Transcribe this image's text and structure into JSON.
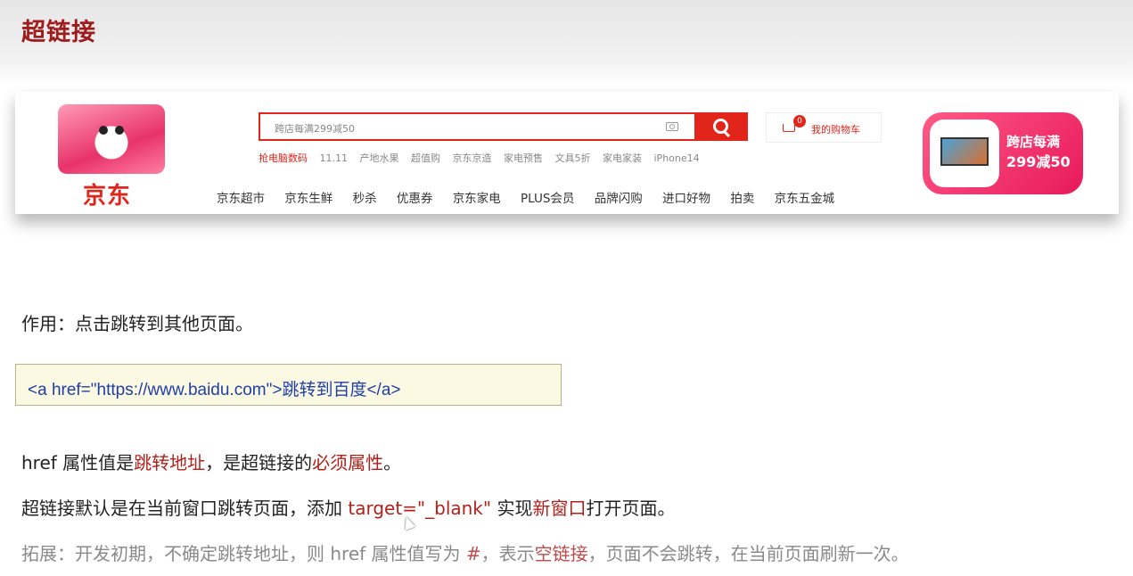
{
  "slide": {
    "title": "超链接"
  },
  "jd": {
    "logo_text": "京东",
    "search_placeholder": "跨店每满299减50",
    "hotwords": [
      "抢电脑数码",
      "11.11",
      "产地水果",
      "超值购",
      "京东京造",
      "家电预售",
      "文具5折",
      "家电家装",
      "iPhone14"
    ],
    "cart": {
      "count": "0",
      "label": "我的购物车"
    },
    "nav": [
      "京东超市",
      "京东生鲜",
      "秒杀",
      "优惠券",
      "京东家电",
      "PLUS会员",
      "品牌闪购",
      "进口好物",
      "拍卖",
      "京东五金城"
    ],
    "promo": {
      "line1": "跨店每满",
      "line2": "299减50"
    },
    "accent_color": "#e1251b"
  },
  "content": {
    "purpose": "作用：点击跳转到其他页面。",
    "code": "<a href=\"https://www.baidu.com\">跳转到百度</a>",
    "line1": {
      "a": "href 属性值是",
      "b": "跳转地址",
      "c": "，是超链接的",
      "d": "必须属性",
      "e": "。"
    },
    "line2": {
      "a": "超链接默认是在当前窗口跳转页面，添加 ",
      "b": "target=\"_blank\"",
      "c": " 实现",
      "d": "新窗口",
      "e": "打开页面。"
    },
    "line3": {
      "a": "拓展：开发初期，不确定跳转地址，则 href 属性值写为 ",
      "b": "#",
      "c": "，表示",
      "d": "空链接",
      "e": "，页面不会跳转，在当前页面刷新一次。"
    },
    "highlight_color": "#b0211c"
  }
}
